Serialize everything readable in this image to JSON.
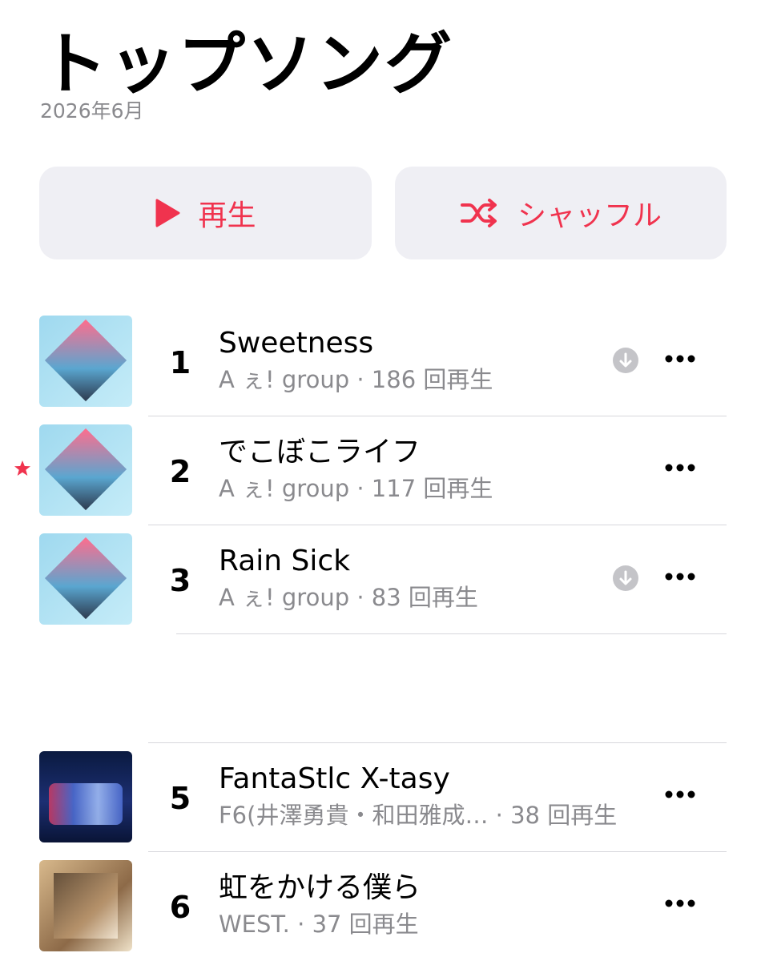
{
  "header": {
    "title": "トップソング",
    "subtitle": "2026年6月"
  },
  "actions": {
    "play_label": "再生",
    "shuffle_label": "シャッフル"
  },
  "accent_color": "#f0334e",
  "songs": [
    {
      "rank": "1",
      "title": "Sweetness",
      "artist": "A ぇ! group",
      "plays": "186 回再生",
      "downloaded": true,
      "starred": false
    },
    {
      "rank": "2",
      "title": "でこぼこライフ",
      "artist": "A ぇ! group",
      "plays": "117 回再生",
      "downloaded": false,
      "starred": true
    },
    {
      "rank": "3",
      "title": "Rain Sick",
      "artist": "A ぇ! group",
      "plays": "83 回再生",
      "downloaded": true,
      "starred": false
    },
    {
      "rank": "5",
      "title": "FantaStlc X-tasy",
      "artist": "F6(井澤勇貴・和田雅成…",
      "plays": "38 回再生",
      "downloaded": false,
      "starred": false
    },
    {
      "rank": "6",
      "title": "虹をかける僕ら",
      "artist": "WEST.",
      "plays": "37 回再生",
      "downloaded": false,
      "starred": false
    }
  ],
  "icons": {
    "play": "play-icon",
    "shuffle": "shuffle-icon",
    "download": "download-icon",
    "more": "more-icon",
    "star": "star-icon"
  }
}
